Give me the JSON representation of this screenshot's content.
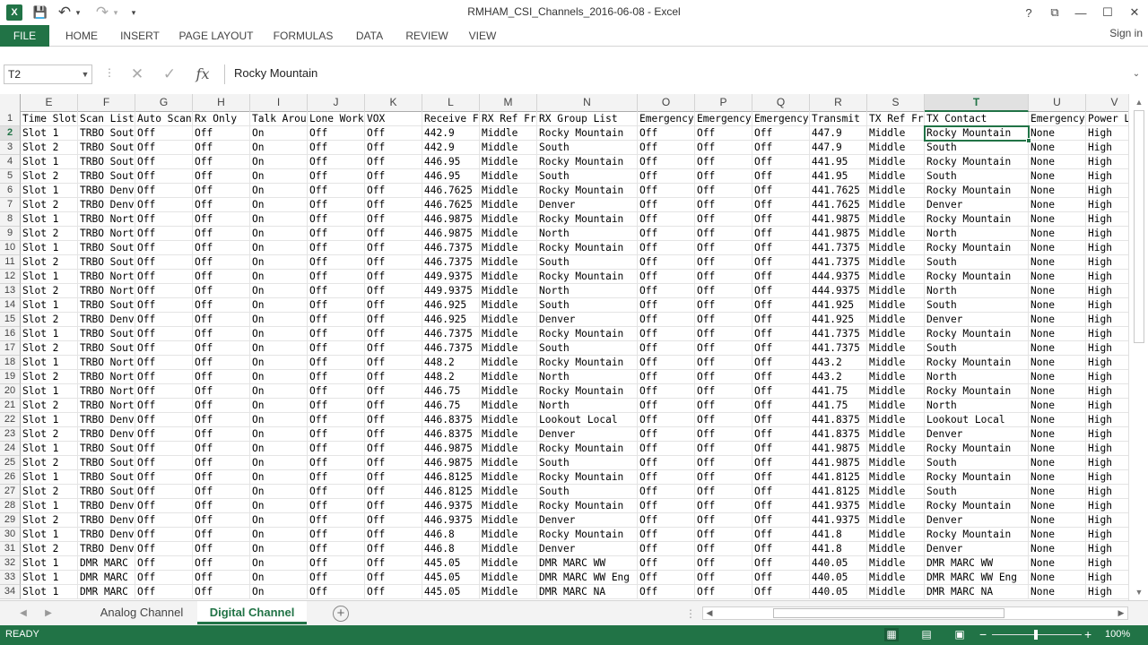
{
  "window": {
    "title": "RMHAM_CSI_Channels_2016-06-08 - Excel",
    "logo_text": "X",
    "qat": {
      "save_icon": "💾",
      "undo_icon": "↶",
      "redo_icon": "↷",
      "customize_icon": "▾"
    },
    "controls": {
      "help": "?",
      "ribbon_display": "⧉",
      "minimize": "—",
      "maximize": "☐",
      "close": "✕"
    }
  },
  "ribbon": {
    "tabs": [
      "FILE",
      "HOME",
      "INSERT",
      "PAGE LAYOUT",
      "FORMULAS",
      "DATA",
      "REVIEW",
      "VIEW"
    ],
    "sign_in": "Sign in"
  },
  "formula_bar": {
    "name_box": "T2",
    "cancel_icon": "✕",
    "enter_icon": "✓",
    "fx_icon": "fx",
    "value": "Rocky Mountain"
  },
  "columns": [
    "E",
    "F",
    "G",
    "H",
    "I",
    "J",
    "K",
    "L",
    "M",
    "N",
    "O",
    "P",
    "Q",
    "R",
    "S",
    "T",
    "U",
    "V"
  ],
  "selected_column": "T",
  "selected_row": "2",
  "rows": [
    {
      "n": "1",
      "c": [
        "Time Slot",
        "Scan List",
        "Auto Scan",
        "Rx Only",
        "Talk Around",
        "Lone Worker",
        "VOX",
        "Receive Fr",
        "RX Ref Fr",
        "RX Group List",
        "Emergency",
        "Emergency",
        "Emergency",
        "Transmit",
        "TX Ref Fr",
        "TX Contact",
        "Emergency",
        "Power Level"
      ]
    },
    {
      "n": "2",
      "c": [
        "Slot 1",
        "TRBO South",
        "Off",
        "Off",
        "On",
        "Off",
        "Off",
        "442.9",
        "Middle",
        "Rocky Mountain",
        "Off",
        "Off",
        "Off",
        "447.9",
        "Middle",
        "Rocky Mountain",
        "None",
        "High"
      ]
    },
    {
      "n": "3",
      "c": [
        "Slot 2",
        "TRBO South",
        "Off",
        "Off",
        "On",
        "Off",
        "Off",
        "442.9",
        "Middle",
        "South",
        "Off",
        "Off",
        "Off",
        "447.9",
        "Middle",
        "South",
        "None",
        "High"
      ]
    },
    {
      "n": "4",
      "c": [
        "Slot 1",
        "TRBO South",
        "Off",
        "Off",
        "On",
        "Off",
        "Off",
        "446.95",
        "Middle",
        "Rocky Mountain",
        "Off",
        "Off",
        "Off",
        "441.95",
        "Middle",
        "Rocky Mountain",
        "None",
        "High"
      ]
    },
    {
      "n": "5",
      "c": [
        "Slot 2",
        "TRBO South",
        "Off",
        "Off",
        "On",
        "Off",
        "Off",
        "446.95",
        "Middle",
        "South",
        "Off",
        "Off",
        "Off",
        "441.95",
        "Middle",
        "South",
        "None",
        "High"
      ]
    },
    {
      "n": "6",
      "c": [
        "Slot 1",
        "TRBO Denver",
        "Off",
        "Off",
        "On",
        "Off",
        "Off",
        "446.7625",
        "Middle",
        "Rocky Mountain",
        "Off",
        "Off",
        "Off",
        "441.7625",
        "Middle",
        "Rocky Mountain",
        "None",
        "High"
      ]
    },
    {
      "n": "7",
      "c": [
        "Slot 2",
        "TRBO Denver",
        "Off",
        "Off",
        "On",
        "Off",
        "Off",
        "446.7625",
        "Middle",
        "Denver",
        "Off",
        "Off",
        "Off",
        "441.7625",
        "Middle",
        "Denver",
        "None",
        "High"
      ]
    },
    {
      "n": "8",
      "c": [
        "Slot 1",
        "TRBO North",
        "Off",
        "Off",
        "On",
        "Off",
        "Off",
        "446.9875",
        "Middle",
        "Rocky Mountain",
        "Off",
        "Off",
        "Off",
        "441.9875",
        "Middle",
        "Rocky Mountain",
        "None",
        "High"
      ]
    },
    {
      "n": "9",
      "c": [
        "Slot 2",
        "TRBO North",
        "Off",
        "Off",
        "On",
        "Off",
        "Off",
        "446.9875",
        "Middle",
        "North",
        "Off",
        "Off",
        "Off",
        "441.9875",
        "Middle",
        "North",
        "None",
        "High"
      ]
    },
    {
      "n": "10",
      "c": [
        "Slot 1",
        "TRBO South",
        "Off",
        "Off",
        "On",
        "Off",
        "Off",
        "446.7375",
        "Middle",
        "Rocky Mountain",
        "Off",
        "Off",
        "Off",
        "441.7375",
        "Middle",
        "Rocky Mountain",
        "None",
        "High"
      ]
    },
    {
      "n": "11",
      "c": [
        "Slot 2",
        "TRBO South",
        "Off",
        "Off",
        "On",
        "Off",
        "Off",
        "446.7375",
        "Middle",
        "South",
        "Off",
        "Off",
        "Off",
        "441.7375",
        "Middle",
        "South",
        "None",
        "High"
      ]
    },
    {
      "n": "12",
      "c": [
        "Slot 1",
        "TRBO North",
        "Off",
        "Off",
        "On",
        "Off",
        "Off",
        "449.9375",
        "Middle",
        "Rocky Mountain",
        "Off",
        "Off",
        "Off",
        "444.9375",
        "Middle",
        "Rocky Mountain",
        "None",
        "High"
      ]
    },
    {
      "n": "13",
      "c": [
        "Slot 2",
        "TRBO North",
        "Off",
        "Off",
        "On",
        "Off",
        "Off",
        "449.9375",
        "Middle",
        "North",
        "Off",
        "Off",
        "Off",
        "444.9375",
        "Middle",
        "North",
        "None",
        "High"
      ]
    },
    {
      "n": "14",
      "c": [
        "Slot 1",
        "TRBO South",
        "Off",
        "Off",
        "On",
        "Off",
        "Off",
        "446.925",
        "Middle",
        "South",
        "Off",
        "Off",
        "Off",
        "441.925",
        "Middle",
        "South",
        "None",
        "High"
      ]
    },
    {
      "n": "15",
      "c": [
        "Slot 2",
        "TRBO Denver",
        "Off",
        "Off",
        "On",
        "Off",
        "Off",
        "446.925",
        "Middle",
        "Denver",
        "Off",
        "Off",
        "Off",
        "441.925",
        "Middle",
        "Denver",
        "None",
        "High"
      ]
    },
    {
      "n": "16",
      "c": [
        "Slot 1",
        "TRBO South",
        "Off",
        "Off",
        "On",
        "Off",
        "Off",
        "446.7375",
        "Middle",
        "Rocky Mountain",
        "Off",
        "Off",
        "Off",
        "441.7375",
        "Middle",
        "Rocky Mountain",
        "None",
        "High"
      ]
    },
    {
      "n": "17",
      "c": [
        "Slot 2",
        "TRBO South",
        "Off",
        "Off",
        "On",
        "Off",
        "Off",
        "446.7375",
        "Middle",
        "South",
        "Off",
        "Off",
        "Off",
        "441.7375",
        "Middle",
        "South",
        "None",
        "High"
      ]
    },
    {
      "n": "18",
      "c": [
        "Slot 1",
        "TRBO North",
        "Off",
        "Off",
        "On",
        "Off",
        "Off",
        "448.2",
        "Middle",
        "Rocky Mountain",
        "Off",
        "Off",
        "Off",
        "443.2",
        "Middle",
        "Rocky Mountain",
        "None",
        "High"
      ]
    },
    {
      "n": "19",
      "c": [
        "Slot 2",
        "TRBO North",
        "Off",
        "Off",
        "On",
        "Off",
        "Off",
        "448.2",
        "Middle",
        "North",
        "Off",
        "Off",
        "Off",
        "443.2",
        "Middle",
        "North",
        "None",
        "High"
      ]
    },
    {
      "n": "20",
      "c": [
        "Slot 1",
        "TRBO North",
        "Off",
        "Off",
        "On",
        "Off",
        "Off",
        "446.75",
        "Middle",
        "Rocky Mountain",
        "Off",
        "Off",
        "Off",
        "441.75",
        "Middle",
        "Rocky Mountain",
        "None",
        "High"
      ]
    },
    {
      "n": "21",
      "c": [
        "Slot 2",
        "TRBO North",
        "Off",
        "Off",
        "On",
        "Off",
        "Off",
        "446.75",
        "Middle",
        "North",
        "Off",
        "Off",
        "Off",
        "441.75",
        "Middle",
        "North",
        "None",
        "High"
      ]
    },
    {
      "n": "22",
      "c": [
        "Slot 1",
        "TRBO Denver",
        "Off",
        "Off",
        "On",
        "Off",
        "Off",
        "446.8375",
        "Middle",
        "Lookout Local",
        "Off",
        "Off",
        "Off",
        "441.8375",
        "Middle",
        "Lookout Local",
        "None",
        "High"
      ]
    },
    {
      "n": "23",
      "c": [
        "Slot 2",
        "TRBO Denver",
        "Off",
        "Off",
        "On",
        "Off",
        "Off",
        "446.8375",
        "Middle",
        "Denver",
        "Off",
        "Off",
        "Off",
        "441.8375",
        "Middle",
        "Denver",
        "None",
        "High"
      ]
    },
    {
      "n": "24",
      "c": [
        "Slot 1",
        "TRBO South",
        "Off",
        "Off",
        "On",
        "Off",
        "Off",
        "446.9875",
        "Middle",
        "Rocky Mountain",
        "Off",
        "Off",
        "Off",
        "441.9875",
        "Middle",
        "Rocky Mountain",
        "None",
        "High"
      ]
    },
    {
      "n": "25",
      "c": [
        "Slot 2",
        "TRBO South",
        "Off",
        "Off",
        "On",
        "Off",
        "Off",
        "446.9875",
        "Middle",
        "South",
        "Off",
        "Off",
        "Off",
        "441.9875",
        "Middle",
        "South",
        "None",
        "High"
      ]
    },
    {
      "n": "26",
      "c": [
        "Slot 1",
        "TRBO South",
        "Off",
        "Off",
        "On",
        "Off",
        "Off",
        "446.8125",
        "Middle",
        "Rocky Mountain",
        "Off",
        "Off",
        "Off",
        "441.8125",
        "Middle",
        "Rocky Mountain",
        "None",
        "High"
      ]
    },
    {
      "n": "27",
      "c": [
        "Slot 2",
        "TRBO South",
        "Off",
        "Off",
        "On",
        "Off",
        "Off",
        "446.8125",
        "Middle",
        "South",
        "Off",
        "Off",
        "Off",
        "441.8125",
        "Middle",
        "South",
        "None",
        "High"
      ]
    },
    {
      "n": "28",
      "c": [
        "Slot 1",
        "TRBO Denver",
        "Off",
        "Off",
        "On",
        "Off",
        "Off",
        "446.9375",
        "Middle",
        "Rocky Mountain",
        "Off",
        "Off",
        "Off",
        "441.9375",
        "Middle",
        "Rocky Mountain",
        "None",
        "High"
      ]
    },
    {
      "n": "29",
      "c": [
        "Slot 2",
        "TRBO Denver",
        "Off",
        "Off",
        "On",
        "Off",
        "Off",
        "446.9375",
        "Middle",
        "Denver",
        "Off",
        "Off",
        "Off",
        "441.9375",
        "Middle",
        "Denver",
        "None",
        "High"
      ]
    },
    {
      "n": "30",
      "c": [
        "Slot 1",
        "TRBO Denver",
        "Off",
        "Off",
        "On",
        "Off",
        "Off",
        "446.8",
        "Middle",
        "Rocky Mountain",
        "Off",
        "Off",
        "Off",
        "441.8",
        "Middle",
        "Rocky Mountain",
        "None",
        "High"
      ]
    },
    {
      "n": "31",
      "c": [
        "Slot 2",
        "TRBO Denver",
        "Off",
        "Off",
        "On",
        "Off",
        "Off",
        "446.8",
        "Middle",
        "Denver",
        "Off",
        "Off",
        "Off",
        "441.8",
        "Middle",
        "Denver",
        "None",
        "High"
      ]
    },
    {
      "n": "32",
      "c": [
        "Slot 1",
        "DMR MARC",
        "Off",
        "Off",
        "On",
        "Off",
        "Off",
        "445.05",
        "Middle",
        "DMR MARC WW",
        "Off",
        "Off",
        "Off",
        "440.05",
        "Middle",
        "DMR MARC WW",
        "None",
        "High"
      ]
    },
    {
      "n": "33",
      "c": [
        "Slot 1",
        "DMR MARC",
        "Off",
        "Off",
        "On",
        "Off",
        "Off",
        "445.05",
        "Middle",
        "DMR MARC WW Eng",
        "Off",
        "Off",
        "Off",
        "440.05",
        "Middle",
        "DMR MARC WW Eng",
        "None",
        "High"
      ]
    },
    {
      "n": "34",
      "c": [
        "Slot 1",
        "DMR MARC",
        "Off",
        "Off",
        "On",
        "Off",
        "Off",
        "445.05",
        "Middle",
        "DMR MARC NA",
        "Off",
        "Off",
        "Off",
        "440.05",
        "Middle",
        "DMR MARC NA",
        "None",
        "High"
      ]
    }
  ],
  "sheets": {
    "tabs": [
      "Analog Channel",
      "Digital Channel"
    ],
    "active": "Digital Channel",
    "add_icon": "+"
  },
  "status": {
    "ready": "READY",
    "zoom": "100%",
    "zoom_minus": "−",
    "zoom_plus": "+",
    "views": [
      "▦",
      "▤",
      "▣"
    ]
  },
  "colors": {
    "accent": "#217346",
    "grid": "#e4e4e4",
    "header_bg": "#f3f3f3"
  }
}
